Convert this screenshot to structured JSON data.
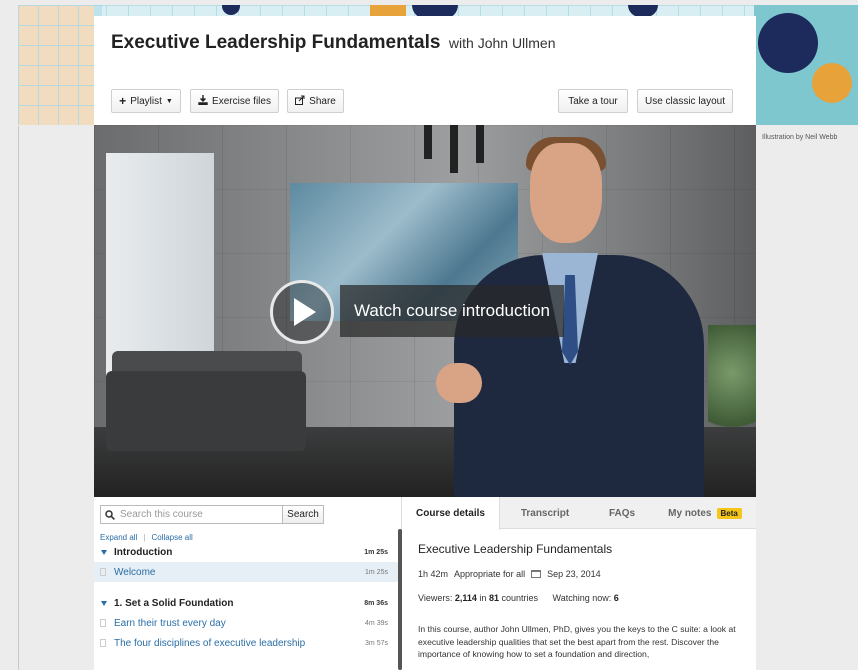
{
  "course": {
    "title": "Executive Leadership Fundamentals",
    "author": "with John Ullmen"
  },
  "toolbar": {
    "playlist_label": "Playlist",
    "exercise_label": "Exercise files",
    "share_label": "Share",
    "tour_label": "Take a tour",
    "classic_label": "Use classic layout"
  },
  "banner": {
    "credit": "Illustration by Neil Webb"
  },
  "video": {
    "watch_label": "Watch course introduction"
  },
  "toc": {
    "search_placeholder": "Search this course",
    "search_button": "Search",
    "expand_all": "Expand all",
    "separator": "|",
    "collapse_all": "Collapse all",
    "items": [
      {
        "type": "section",
        "label": "Introduction",
        "duration": "1m 25s"
      },
      {
        "type": "video",
        "label": "Welcome",
        "duration": "1m 25s",
        "active": true
      },
      {
        "type": "section",
        "label": "1. Set a Solid Foundation",
        "duration": "8m 36s"
      },
      {
        "type": "video",
        "label": "Earn their trust every day",
        "duration": "4m 39s"
      },
      {
        "type": "video",
        "label": "The four disciplines of executive leadership",
        "duration": "3m 57s"
      }
    ]
  },
  "details": {
    "tabs": [
      "Course details",
      "Transcript",
      "FAQs",
      "My notes"
    ],
    "beta_badge": "Beta",
    "title": "Executive Leadership Fundamentals",
    "duration": "1h 42m",
    "level": "Appropriate for all",
    "date": "Sep 23, 2014",
    "viewers_label": "Viewers:",
    "viewers_count": "2,114",
    "in_word": "in",
    "countries_count": "81",
    "countries_word": "countries",
    "watching_label": "Watching now:",
    "watching_count": "6",
    "description": "In this course, author John Ullmen, PhD, gives you the keys to the C suite: a look at executive leadership qualities that set the best apart from the rest. Discover the importance of knowing how to set a foundation and direction,"
  },
  "colors": {
    "link": "#2a6ea6",
    "beta": "#f5c518",
    "active_row": "#e6eef6"
  }
}
